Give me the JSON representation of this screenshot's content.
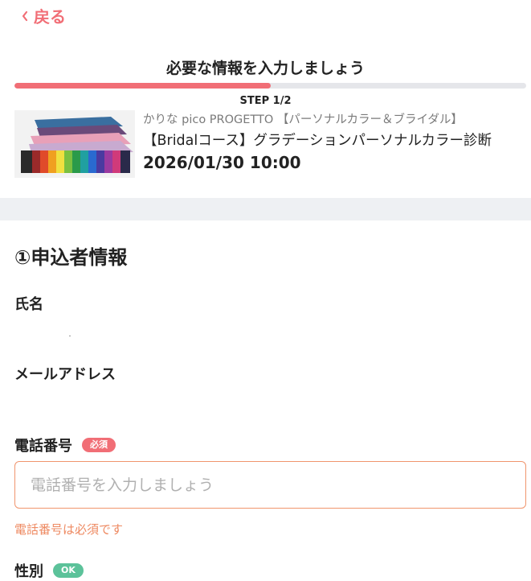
{
  "nav": {
    "back_label": "戻る"
  },
  "header": {
    "title": "必要な情報を入力しましょう",
    "step": "STEP 1/2",
    "progress": 0.5
  },
  "booking": {
    "shop": "かりな pico PROGETTO 【パーソナルカラー＆ブライダル】",
    "course": "【Bridalコース】グラデーションパーソナルカラー診断",
    "datetime": "2026/01/30 10:00"
  },
  "form": {
    "section_title": "①申込者情報",
    "name_label": "氏名",
    "email_label": "メールアドレス",
    "phone_label": "電話番号",
    "phone_required": "必須",
    "phone_placeholder": "電話番号を入力しましょう",
    "phone_error": "電話番号は必須です",
    "gender_label": "性別",
    "gender_badge": "OK"
  },
  "colors": {
    "accent": "#f16e76",
    "error": "#ee8a62",
    "ok": "#5cc29a"
  }
}
